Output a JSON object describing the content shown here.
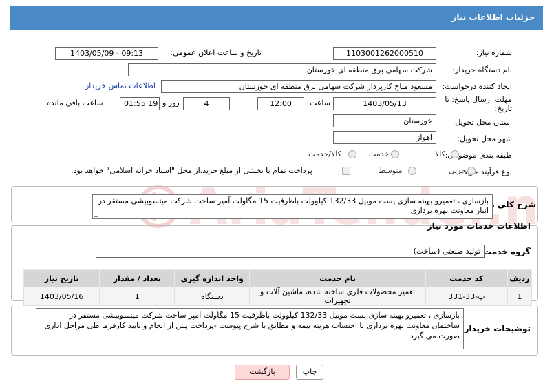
{
  "header": {
    "title": "جزئیات اطلاعات نیاز"
  },
  "form": {
    "need_number_label": "شماره نیاز:",
    "need_number": "1103001262000510",
    "announce_label": "تاریخ و ساعت اعلان عمومی:",
    "announce_value": "1403/05/09 - 09:13",
    "buyer_org_label": "نام دستگاه خریدار:",
    "buyer_org": "شرکت سهامی برق منطقه ای خوزستان",
    "creator_label": "ایجاد کننده درخواست:",
    "creator": "مسعود میاح کارپرداز شرکت سهامی برق منطقه ای خوزستان",
    "contact_link": "اطلاعات تماس خریدار",
    "deadline_label_1": "مهلت ارسال پاسخ: تا",
    "deadline_label_2": "تاریخ:",
    "deadline_date": "1403/05/13",
    "time_label": "ساعت",
    "deadline_time": "12:00",
    "days_value": "4",
    "days_label": "روز و",
    "remaining_time": "01:55:19",
    "remaining_label": "ساعت باقی مانده",
    "province_label": "استان محل تحویل:",
    "province": "خوزستان",
    "city_label": "شهر محل تحویل:",
    "city": "اهواز",
    "category_label": "طبقه بندی موضوعی:",
    "category_options": [
      "کالا",
      "خدمت",
      "کالا/خدمت"
    ],
    "process_label": "نوع فرآیند خرید :",
    "process_options": [
      "جزیی",
      "متوسط"
    ],
    "payment_note": "پرداخت تمام یا بخشی از مبلغ خرید،از محل \"اسناد خزانه اسلامی\" خواهد بود."
  },
  "summary": {
    "label": "شرح کلی نیاز:",
    "text": "بازسازی ، تعمیرو بهینه سازی پست موبیل 132/33 کیلوولت باظرفیت 15 مگاولت آمپر ساخت شرکت میتسوبیشی مستقر در انبار معاونت بهره برداری"
  },
  "services": {
    "section_title": "اطلاعات خدمات مورد نیاز",
    "group_label": "گروه خدمت:",
    "group_value": "تولید صنعتی (ساخت)",
    "columns": [
      "ردیف",
      "کد خدمت",
      "نام خدمت",
      "واحد اندازه گیری",
      "تعداد / مقدار",
      "تاریخ نیاز"
    ],
    "rows": [
      [
        "1",
        "پ-33-331",
        "تعمیر محصولات فلزی ساخته شده، ماشین آلات و تجهیزات",
        "دستگاه",
        "1",
        "1403/05/16"
      ]
    ]
  },
  "buyer_notes": {
    "label": "توضیحات خریدار:",
    "text": "بازسازی ، تعمیرو بهینه سازی پست موبیل 132/33 کیلوولت باظرفیت 15 مگاولت آمپر ساخت شرکت میتسوبیشی مستقر در ساختمان معاونت بهره برداری با احتساب هزینه بیمه و مطابق با شرح پیوست -پرداخت پس از انجام و تایید کارفرما طی مراحل اداری صورت می گیرد"
  },
  "buttons": {
    "print": "چاپ",
    "back": "بازگشت"
  },
  "watermark": {
    "text": "AriaTender.neT"
  }
}
